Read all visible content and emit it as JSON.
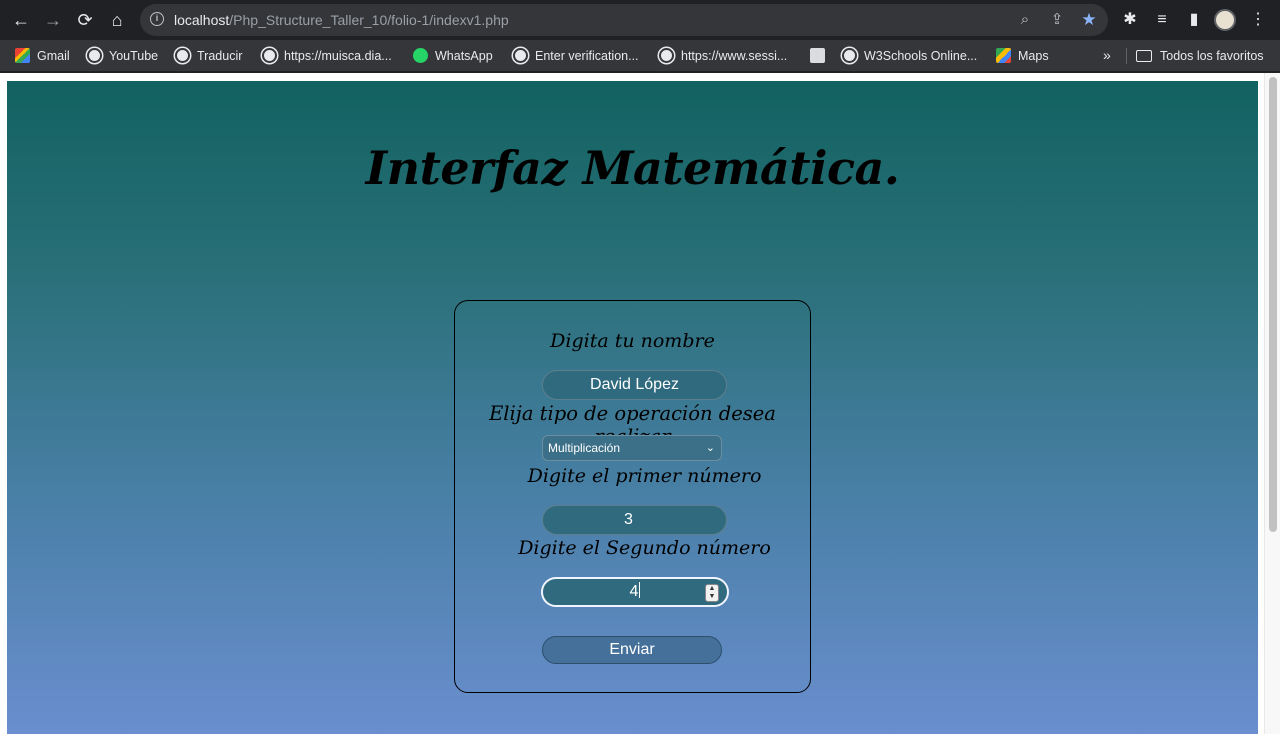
{
  "browser": {
    "url_host": "localhost",
    "url_path": "/Php_Structure_Taller_10/folio-1/indexv1.php",
    "bookmarks": [
      {
        "label": "Gmail",
        "icon": "gmail-icon"
      },
      {
        "label": "YouTube",
        "icon": "globe-icon"
      },
      {
        "label": "Traducir",
        "icon": "globe-icon"
      },
      {
        "label": "https://muisca.dia...",
        "icon": "globe-icon"
      },
      {
        "label": "WhatsApp",
        "icon": "whatsapp-icon"
      },
      {
        "label": "Enter verification...",
        "icon": "globe-icon"
      },
      {
        "label": "https://www.sessi...",
        "icon": "globe-icon"
      },
      {
        "label": "",
        "icon": "image-icon"
      },
      {
        "label": "W3Schools Online...",
        "icon": "globe-icon"
      },
      {
        "label": "Maps",
        "icon": "maps-icon"
      }
    ],
    "all_bookmarks_label": "Todos los favoritos",
    "more_label": "»"
  },
  "page": {
    "title": "Interfaz Matemática.",
    "form": {
      "name_label": "Digita tu nombre",
      "name_value": "David López",
      "operation_label": "Elija tipo de operación desea realizar",
      "operation_selected": "Multiplicación",
      "first_label": "Digite el primer número",
      "first_value": "3",
      "second_label": "Digite el Segundo número",
      "second_value": "4",
      "submit_label": "Enviar"
    }
  },
  "colors": {
    "gradient_top": "#126261",
    "gradient_bottom": "#6a8ece",
    "field_bg": "#2f6a7e",
    "button_bg": "#44709a"
  }
}
